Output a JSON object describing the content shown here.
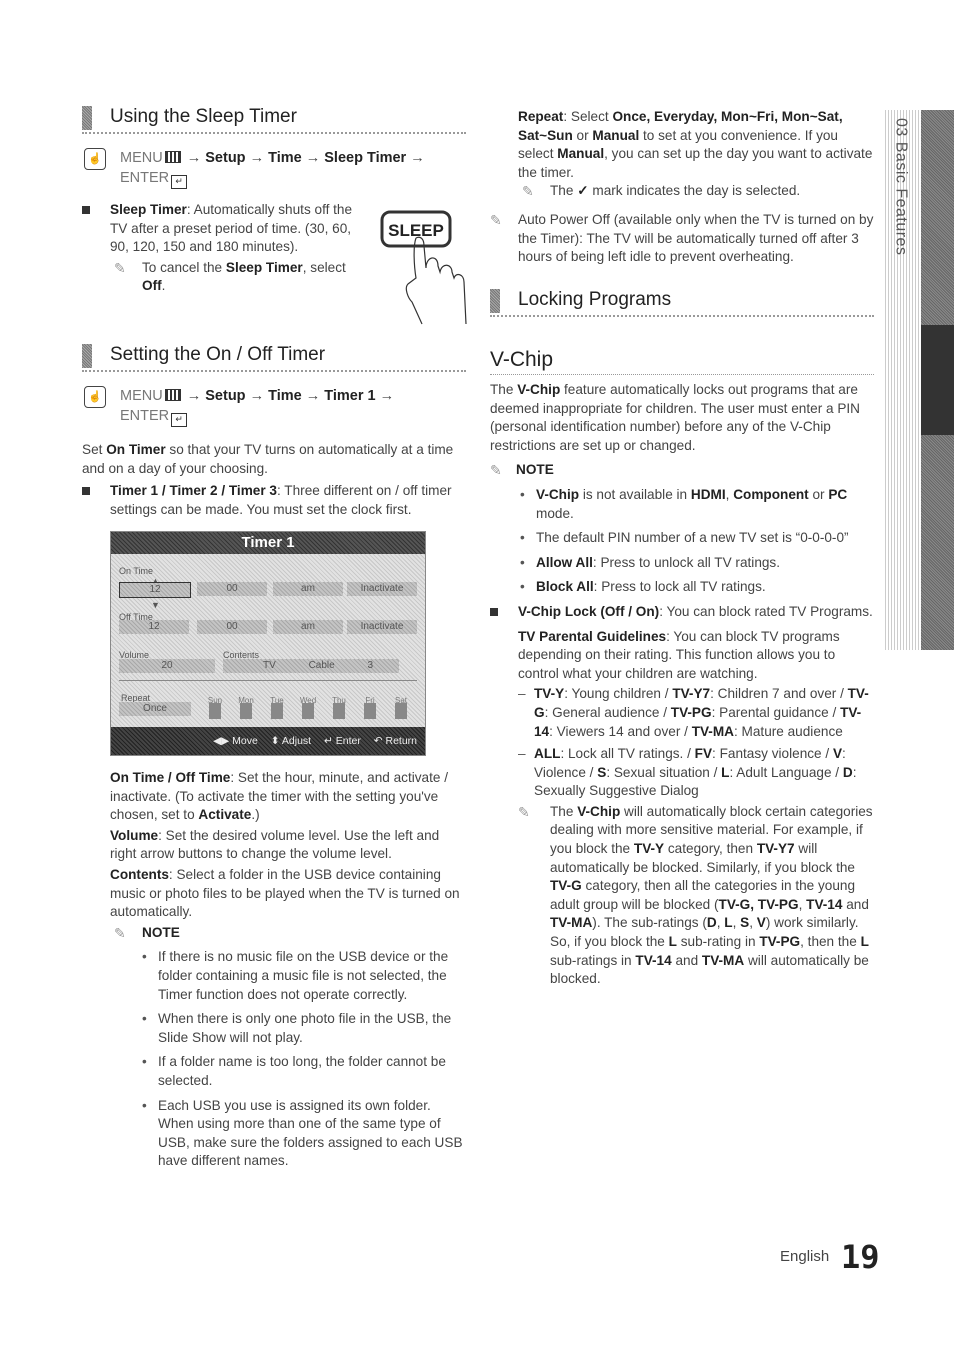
{
  "left": {
    "sleep": {
      "title": "Using the Sleep Timer",
      "path": {
        "menu": "MENU",
        "arrow": "→",
        "steps": [
          "Setup",
          "Time",
          "Sleep Timer"
        ],
        "enter": "ENTER"
      },
      "item_term": "Sleep Timer",
      "item_text": ": Automatically shuts off the TV after a preset period of time. (30, 60, 90, 120, 150 and 180 minutes).",
      "note_pre": "To cancel the ",
      "note_term": "Sleep Timer",
      "note_mid": ", select ",
      "note_val": "Off",
      "note_end": ".",
      "button_label": "SLEEP"
    },
    "onoff": {
      "title": "Setting the On / Off Timer",
      "path": {
        "menu": "MENU",
        "arrow": "→",
        "steps": [
          "Setup",
          "Time",
          "Timer 1"
        ],
        "enter": "ENTER"
      },
      "intro_pre": "Set ",
      "intro_term": "On Timer",
      "intro_post": " so that your TV turns on automatically at a time and on a day of your choosing.",
      "item_term": "Timer 1 / Timer 2 / Timer 3",
      "item_text": ": Three different on / off timer settings can be made. You must set the clock first.",
      "osd": {
        "title": "Timer 1",
        "on_time_label": "On Time",
        "off_time_label": "Off Time",
        "on": [
          "12",
          "00",
          "am",
          "Inactivate"
        ],
        "off": [
          "12",
          "00",
          "am",
          "Inactivate"
        ],
        "volume_label": "Volume",
        "volume": "20",
        "contents_label": "Contents",
        "contents": [
          "TV",
          "Cable",
          "3"
        ],
        "repeat_label": "Repeat",
        "repeat": "Once",
        "days": [
          "Sun",
          "Mon",
          "Tue",
          "Wed",
          "Thu",
          "Fri",
          "Sat"
        ],
        "footer": [
          "◀▶ Move",
          "⬍ Adjust",
          "↵ Enter",
          "↶ Return"
        ]
      },
      "desc": [
        {
          "term": "On Time / Off Time",
          "text": ": Set the hour, minute, and activate / inactivate. (To activate the timer with the setting you've chosen, set to ",
          "term2": "Activate",
          "text2": ".)"
        },
        {
          "term": "Volume",
          "text": ": Set the desired volume level. Use the left and right arrow buttons to change the volume level."
        },
        {
          "term": "Contents",
          "text": ": Select a folder in the USB device containing music or photo files to be played when the TV is turned on automatically."
        }
      ],
      "note_label": "NOTE",
      "notes": [
        "If there is no music file on the USB device or the folder containing a music file is not selected, the Timer function does not operate correctly.",
        "When there is only one photo file in the USB, the Slide Show will not play.",
        "If a folder name is too long, the folder cannot be selected.",
        "Each USB you use is assigned its own folder. When using more than one of the same type of USB, make sure the folders assigned to each USB have different names."
      ]
    }
  },
  "right": {
    "repeat": {
      "t1": "Repeat",
      "t2": ": Select ",
      "t3": "Once, Everyday, Mon~Fri, Mon~Sat, Sat~Sun",
      "t4": " or ",
      "t5": "Manual",
      "t6": " to set at you convenience. If you select ",
      "t7": "Manual",
      "t8": ", you can set up the day you want to activate the timer.",
      "note_pre": "The ",
      "note_check": "✓",
      "note_post": " mark indicates the day is selected."
    },
    "auto_power_off": "Auto Power Off (available only when the TV is turned on by the Timer): The TV will be automatically turned off after 3 hours of being left idle to prevent overheating.",
    "locking_title": "Locking Programs",
    "vchip": {
      "title": "V-Chip",
      "intro_pre": "The ",
      "intro_term": "V-Chip",
      "intro_post": " feature automatically locks out programs that are deemed inappropriate for children. The user must enter a PIN (personal identification number) before any of the V-Chip restrictions are set up or changed.",
      "note_label": "NOTE",
      "n1_a": "V-Chip",
      "n1_b": " is not available in ",
      "n1_c": "HDMI",
      "n1_d": ", ",
      "n1_e": "Component",
      "n1_f": " or ",
      "n1_g": "PC",
      "n1_h": " mode.",
      "n2": "The default PIN number of a new TV set is “0-0-0-0”",
      "n3_a": "Allow All",
      "n3_b": ": Press to unlock all TV ratings.",
      "n4_a": "Block All",
      "n4_b": ": Press to lock all TV ratings.",
      "lock_term": "V-Chip Lock (Off / On)",
      "lock_text": ": You can block rated TV Programs.",
      "pg_term": "TV Parental Guidelines",
      "pg_text": ": You can block TV programs depending on their rating. This function allows you to control what your children are watching.",
      "ratings": [
        {
          "k": "TV-Y",
          "v": ": Young children / "
        },
        {
          "k": "TV-Y7",
          "v": ": Children 7 and over / "
        },
        {
          "k": "TV-G",
          "v": ": General audience / "
        },
        {
          "k": "TV-PG",
          "v": ": Parental guidance / "
        },
        {
          "k": "TV-14",
          "v": ": Viewers 14 and over / "
        },
        {
          "k": "TV-MA",
          "v": ": Mature audience"
        }
      ],
      "subratings": [
        {
          "k": "ALL",
          "v": ": Lock all TV ratings. / "
        },
        {
          "k": "FV",
          "v": ": Fantasy violence / "
        },
        {
          "k": "V",
          "v": ": Violence / "
        },
        {
          "k": "S",
          "v": ": Sexual situation / "
        },
        {
          "k": "L",
          "v": ": Adult Language / "
        },
        {
          "k": "D",
          "v": ": Sexually Suggestive Dialog"
        }
      ],
      "final_note": "The <b>V-Chip</b> will automatically block certain categories dealing with more sensitive material. For example, if you block the <b>TV-Y</b> category, then <b>TV-Y7</b> will automatically be blocked. Similarly, if you block the <b>TV-G</b> category, then all the categories in the young adult group will be blocked (<b>TV-G, TV-PG</b>, <b>TV-14</b> and <b>TV-MA</b>). The sub-ratings (<b>D</b>, <b>L</b>, <b>S</b>, <b>V</b>) work similarly. So, if you block the <b>L</b> sub-rating in <b>TV-PG</b>, then the <b>L</b> sub-ratings in <b>TV-14</b> and <b>TV-MA</b> will automatically be blocked."
    }
  },
  "side_tab": "03  Basic Features",
  "footer": {
    "language": "English",
    "page": "19"
  }
}
